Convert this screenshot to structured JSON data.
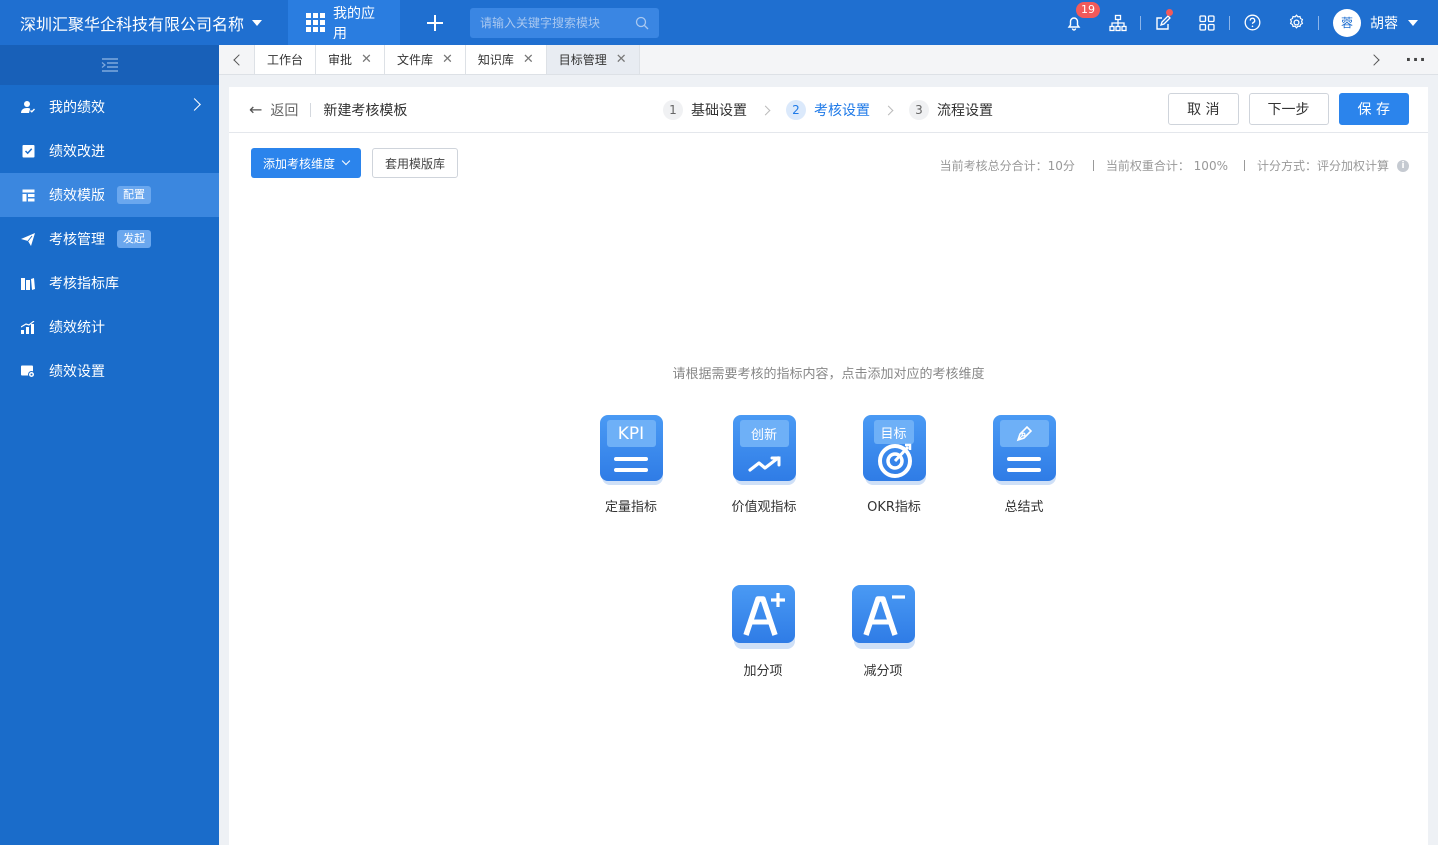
{
  "header": {
    "company": "深圳汇聚华企科技有限公司名称",
    "my_apps": "我的应用",
    "search_placeholder": "请输入关键字搜索模块",
    "notification_count": "19",
    "user_avatar": "蓉",
    "user_name": "胡蓉"
  },
  "sidebar": {
    "items": [
      {
        "label": "我的绩效",
        "icon": "user-icon"
      },
      {
        "label": "绩效改进",
        "icon": "checklist-icon"
      },
      {
        "label": "绩效模版",
        "icon": "template-icon",
        "tag": "配置"
      },
      {
        "label": "考核管理",
        "icon": "send-icon",
        "tag": "发起"
      },
      {
        "label": "考核指标库",
        "icon": "library-icon"
      },
      {
        "label": "绩效统计",
        "icon": "stats-icon"
      },
      {
        "label": "绩效设置",
        "icon": "settings-doc-icon"
      }
    ]
  },
  "tabs": [
    {
      "label": "工作台",
      "closable": false
    },
    {
      "label": "审批",
      "closable": true
    },
    {
      "label": "文件库",
      "closable": true
    },
    {
      "label": "知识库",
      "closable": true
    },
    {
      "label": "目标管理",
      "closable": true,
      "active": true
    }
  ],
  "page": {
    "back": "返回",
    "title": "新建考核模板",
    "steps": [
      {
        "num": "1",
        "label": "基础设置"
      },
      {
        "num": "2",
        "label": "考核设置",
        "active": true
      },
      {
        "num": "3",
        "label": "流程设置"
      }
    ],
    "cancel": "取 消",
    "next": "下一步",
    "save": "保 存"
  },
  "toolbar": {
    "add_dimension": "添加考核维度",
    "apply_library": "套用模版库",
    "total_score": "当前考核总分合计：10分",
    "total_weight": "当前权重合计：  100%",
    "calc_method": "计分方式：评分加权计算"
  },
  "content": {
    "hint": "请根据需要考核的指标内容，点击添加对应的考核维度",
    "cards": [
      {
        "label": "定量指标",
        "tag": "KPI"
      },
      {
        "label": "价值观指标",
        "tag": "创新"
      },
      {
        "label": "OKR指标",
        "tag": "目标"
      },
      {
        "label": "总结式"
      },
      {
        "label": "加分项"
      },
      {
        "label": "减分项"
      }
    ]
  },
  "colors": {
    "brand": "#1f6fd0",
    "sidebar": "#1a6cca",
    "primary": "#2b84ec",
    "badge": "#f25a5a"
  }
}
